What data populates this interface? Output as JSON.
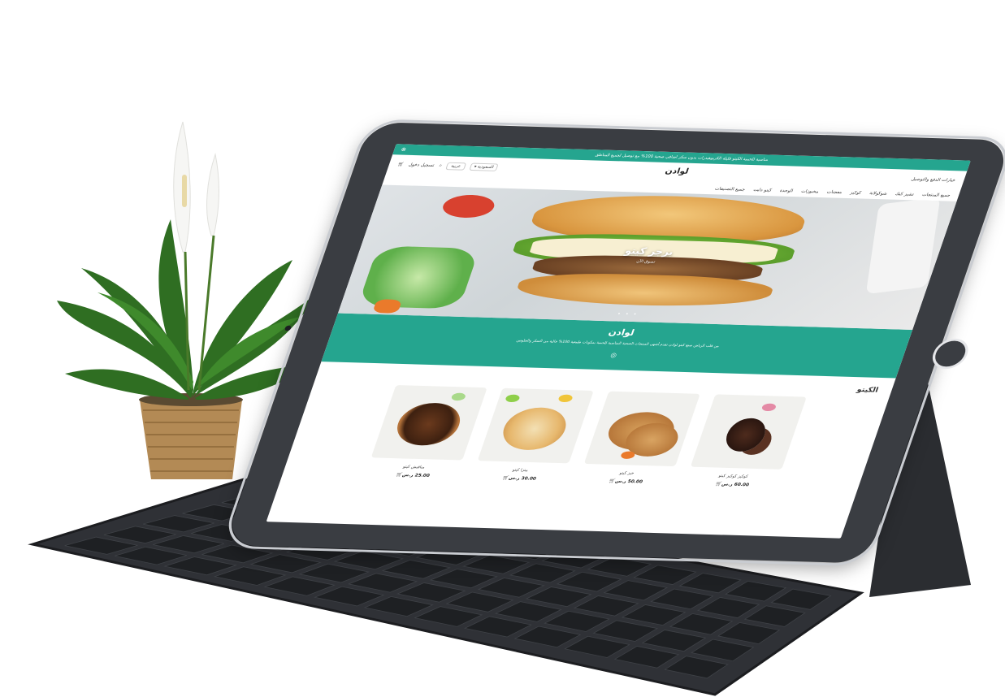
{
  "store": {
    "announcement": "مناسبة للحمية الكيتو قليلة الكربوهيدرات بدون سكر اضافي صحية 100% مع توصيل لجميع المناطق",
    "logo_text": "لوادن",
    "account_link": "تسجيل دخول",
    "currency": "عربية",
    "country": "السعودية",
    "payment_shipping": "خيارات الدفع والتوصيل"
  },
  "nav": {
    "items": [
      "جميع المنتجات",
      "تشيز كيك",
      "شوكولاتة",
      "كوكيز",
      "معجنات",
      "مخبوزات",
      "الوحدة",
      "كيتو دايت",
      "جميع التصنيفات"
    ]
  },
  "hero": {
    "title": "برجر كيتو",
    "subtitle": "تسوق الآن",
    "dots": "• • •"
  },
  "brand": {
    "title": "لوادن",
    "description": "من قلب الرياض صنع كيتو لوادن تقدم أشهى المنتجات الصحية المناسبة للحمية بمكونات طبيعية 100% خالية من السكر والجلوتين"
  },
  "section": {
    "title": "الكيتو"
  },
  "products": [
    {
      "name": "كوكيز كوكيز كيتو",
      "price": "60.00 ر.س"
    },
    {
      "name": "خبز كيتو",
      "price": "50.00 ر.س"
    },
    {
      "name": "بيتزا كيتو",
      "price": "30.00 ر.س"
    },
    {
      "name": "مناقيش كيتو",
      "price": "25.00 ر.س"
    }
  ],
  "colors": {
    "accent": "#25a58f",
    "tablet_body": "#3a3d42",
    "keyboard": "#2f3136"
  },
  "icons": [
    "cart-icon",
    "search-icon",
    "instagram-icon",
    "close-icon",
    "chevron-down-icon"
  ]
}
